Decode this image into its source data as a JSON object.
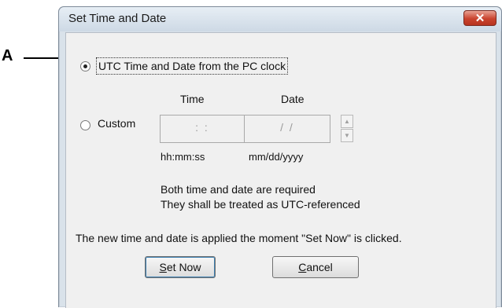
{
  "callout": {
    "letter": "A"
  },
  "window": {
    "title": "Set Time and Date",
    "close_glyph": "✕"
  },
  "options": {
    "utc_label": "UTC Time and Date from the PC clock",
    "utc_selected": true,
    "custom_label": "Custom",
    "custom_selected": false
  },
  "fields": {
    "time_header": "Time",
    "date_header": "Date",
    "time_value": ": :",
    "date_value": "/ /",
    "time_format": "hh:mm:ss",
    "date_format": "mm/dd/yyyy"
  },
  "notes": {
    "line1": "Both time and date are required",
    "line2": "They shall be treated as UTC-referenced",
    "apply": "The new time and date is applied the moment  \"Set Now\" is clicked."
  },
  "buttons": {
    "set_now_mnemonic": "S",
    "set_now_rest": "et Now",
    "cancel_mnemonic": "C",
    "cancel_rest": "ancel"
  },
  "icons": {
    "spin_up": "up-arrow-icon",
    "spin_down": "down-arrow-icon",
    "close": "close-icon"
  }
}
